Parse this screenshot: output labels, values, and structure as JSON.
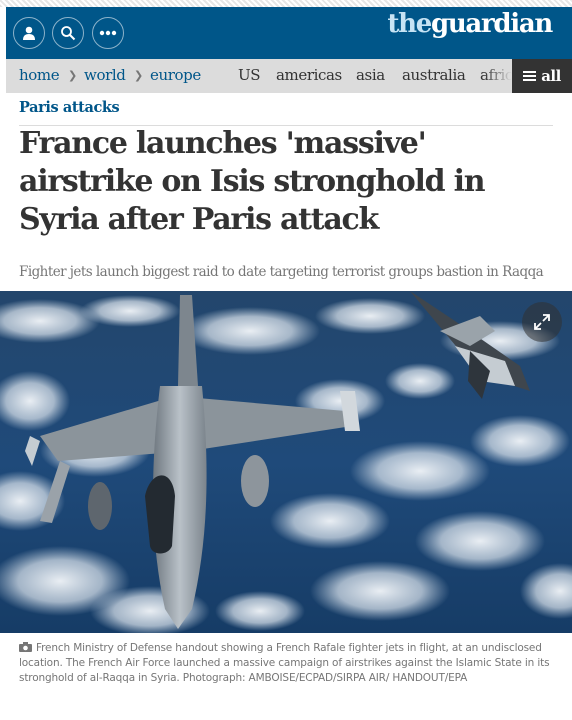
{
  "masthead": {
    "logo_the": "the",
    "logo_rest": "guardian",
    "icons": [
      "profile-icon",
      "search-icon",
      "more-icon"
    ],
    "bg_color": "#005689"
  },
  "nav": {
    "items": [
      {
        "label": "home"
      },
      {
        "label": "world"
      },
      {
        "label": "europe"
      },
      {
        "label": "US"
      },
      {
        "label": "americas"
      },
      {
        "label": "asia"
      },
      {
        "label": "australia"
      },
      {
        "label": "africa"
      }
    ],
    "all_label": "all"
  },
  "article": {
    "section": "Paris attacks",
    "headline": "France launches 'massive' airstrike on Isis stronghold in Syria after Paris attack",
    "standfirst": "Fighter jets launch biggest raid to date targeting terrorist groups bastion in Raqqa",
    "caption": "French Ministry of Defense handout showing a French Rafale fighter jets in flight, at an undisclosed location. The French Air Force launched a massive campaign of airstrikes against the Islamic State in its stronghold of al-Raqqa in Syria. Photograph: AMBOISE/ECPAD/SIRPA AIR/ HANDOUT/EPA"
  }
}
